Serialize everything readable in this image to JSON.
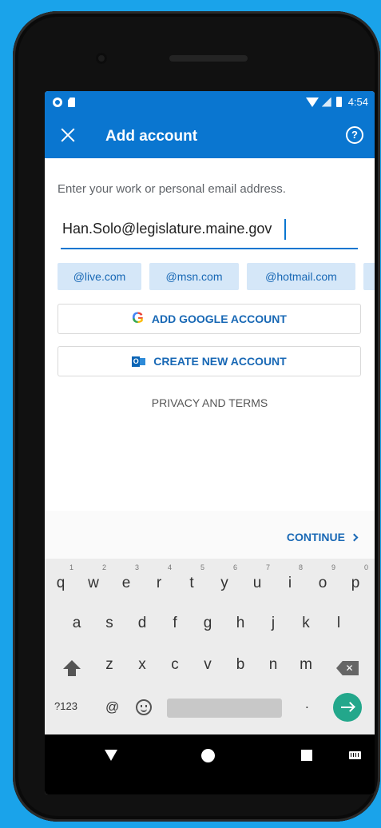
{
  "status_bar": {
    "time": "4:54"
  },
  "app_bar": {
    "title": "Add account",
    "help_label": "?"
  },
  "form": {
    "prompt": "Enter your work or personal email address.",
    "email_value": "Han.Solo@legislature.maine.gov"
  },
  "domain_chips": [
    "@live.com",
    "@msn.com",
    "@hotmail.com"
  ],
  "buttons": {
    "google_icon": "G",
    "google_label": "ADD GOOGLE ACCOUNT",
    "outlook_icon": "O",
    "create_label": "CREATE NEW ACCOUNT",
    "privacy_label": "PRIVACY AND TERMS",
    "continue_label": "CONTINUE"
  },
  "keyboard": {
    "row1": [
      "q",
      "w",
      "e",
      "r",
      "t",
      "y",
      "u",
      "i",
      "o",
      "p"
    ],
    "row1_digits": [
      "1",
      "2",
      "3",
      "4",
      "5",
      "6",
      "7",
      "8",
      "9",
      "0"
    ],
    "row2": [
      "a",
      "s",
      "d",
      "f",
      "g",
      "h",
      "j",
      "k",
      "l"
    ],
    "row3": [
      "z",
      "x",
      "c",
      "v",
      "b",
      "n",
      "m"
    ],
    "symbols_label": "?123",
    "at_label": "@",
    "period_label": ".",
    "backspace_glyph": "✕"
  },
  "colors": {
    "accent": "#0a76d0",
    "chip_bg": "#d5e7f8",
    "link": "#1868b5",
    "enter_key": "#23a78b",
    "background": "#1aa3ea"
  },
  "icons": [
    "close-icon",
    "help-icon",
    "google-icon",
    "outlook-icon",
    "shift-icon",
    "backspace-icon",
    "emoji-icon",
    "enter-icon",
    "nav-back-icon",
    "nav-home-icon",
    "nav-recent-icon",
    "keyboard-icon",
    "wifi-icon",
    "cell-signal-icon",
    "battery-icon"
  ]
}
